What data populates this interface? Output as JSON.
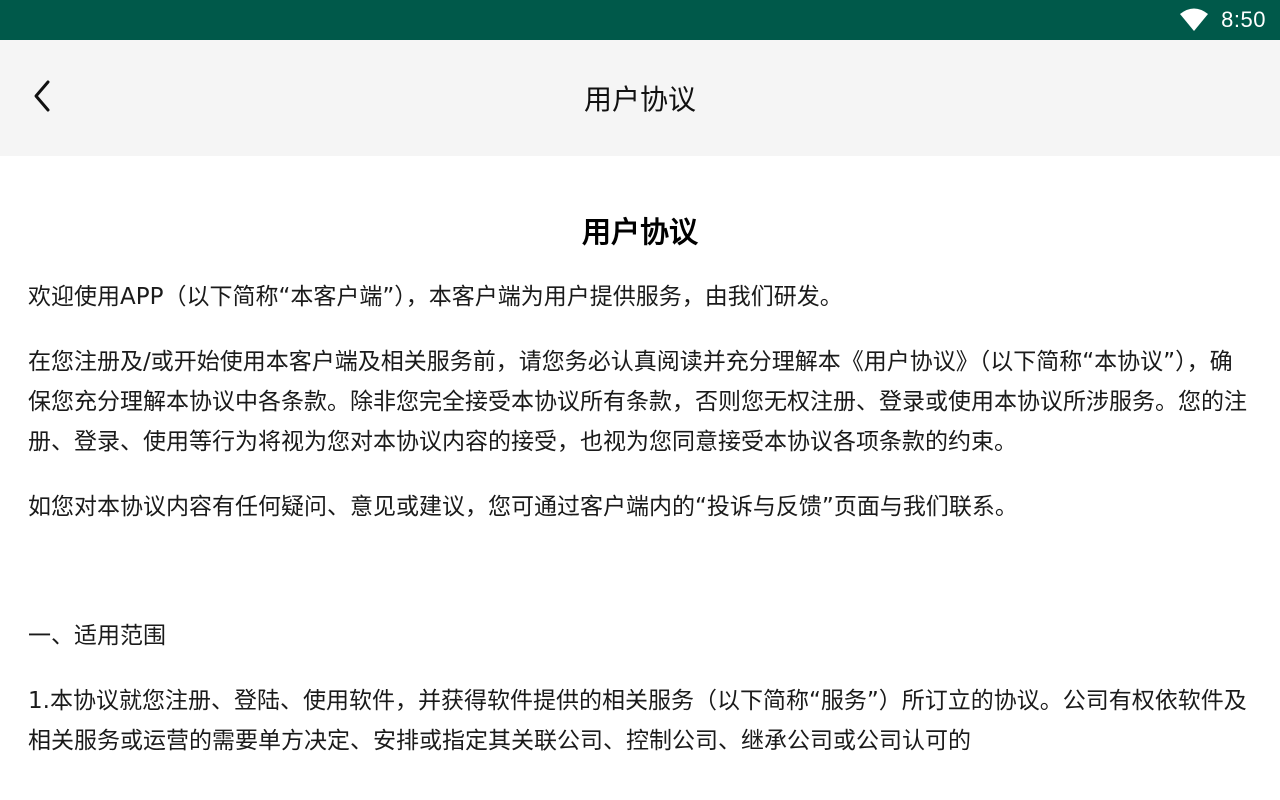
{
  "status_bar": {
    "time": "8:50",
    "wifi_icon": "wifi-icon",
    "bg_color": "#00594a"
  },
  "app_bar": {
    "title": "用户协议",
    "back_icon": "chevron-left-icon"
  },
  "document": {
    "title": "用户协议",
    "paragraphs": [
      "欢迎使用APP（以下简称“本客户端”），本客户端为用户提供服务，由我们研发。",
      "在您注册及/或开始使用本客户端及相关服务前，请您务必认真阅读并充分理解本《用户协议》（以下简称“本协议”），确保您充分理解本协议中各条款。除非您完全接受本协议所有条款，否则您无权注册、登录或使用本协议所涉服务。您的注册、登录、使用等行为将视为您对本协议内容的接受，也视为您同意接受本协议各项条款的约束。",
      "如您对本协议内容有任何疑问、意见或建议，您可通过客户端内的“投诉与反馈”页面与我们联系。",
      "一、适用范围",
      "1.本协议就您注册、登陆、使用软件，并获得软件提供的相关服务（以下简称“服务”）所订立的协议。公司有权依软件及相关服务或运营的需要单方决定、安排或指定其关联公司、控制公司、继承公司或公司认可的"
    ]
  }
}
